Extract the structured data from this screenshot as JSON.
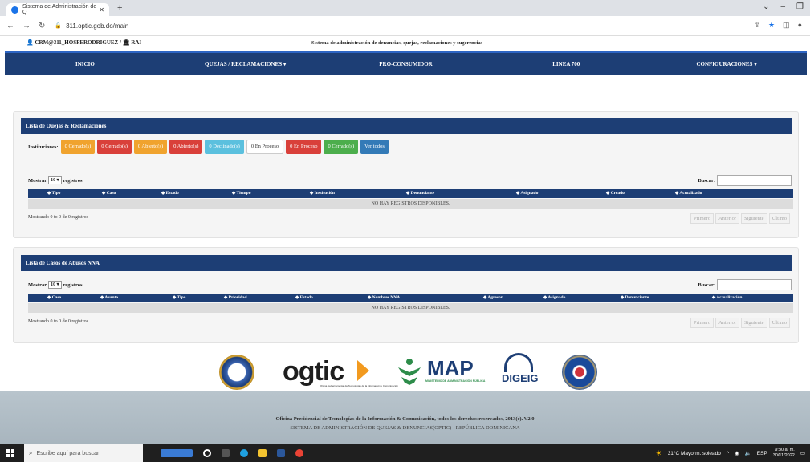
{
  "browser": {
    "tab_title": "Sistema de Administración de Q",
    "url": "311.optic.gob.do/main"
  },
  "header": {
    "user": "CRM@311_HOSPERODRIGUEZ / ",
    "user_suffix": "RAI",
    "system_title": "Sistema de administración de denuncias, quejas, reclamaciones y sugerencias"
  },
  "nav": {
    "items": [
      "INICIO",
      "QUEJAS / RECLAMACIONES ▾",
      "PRO-CONSUMIDOR",
      "LINEA 700",
      "CONFIGURACIONES ▾"
    ]
  },
  "quejas": {
    "title": "Lista de Quejas & Reclamaciones",
    "inst_label": "Instituciones:",
    "buttons": [
      {
        "label": "0 Cerrado(s)",
        "color": "#f0a32e"
      },
      {
        "label": "0 Cerrado(s)",
        "color": "#d9403a"
      },
      {
        "label": "0 Abierto(s)",
        "color": "#f0a32e"
      },
      {
        "label": "0 Abierto(s)",
        "color": "#d9403a"
      },
      {
        "label": "0 Declinado(s)",
        "color": "#5bc0de"
      },
      {
        "label": "0 En Proceso",
        "color": "#ffffff"
      },
      {
        "label": "0 En Proceso",
        "color": "#d9403a"
      },
      {
        "label": "0 Cerrado(s)",
        "color": "#4cae4c"
      },
      {
        "label": "Ver todos",
        "color": "#337ab7"
      }
    ],
    "show_prefix": "Mostrar",
    "show_value": "10",
    "show_suffix": "registros",
    "search_label": "Buscar:",
    "columns": [
      "Tipo",
      "Caso",
      "Estado",
      "Tiempo",
      "Institución",
      "Denunciante",
      "Asignado",
      "Creado",
      "Actualizado"
    ],
    "empty": "NO HAY REGISTROS DISPONIBLES.",
    "info": "Mostrando 0 to 0 de 0 registros",
    "pager": [
      "Primero",
      "Anterior",
      "Siguiente",
      "Ultimo"
    ]
  },
  "nna": {
    "title": "Lista de Casos de Abusos NNA",
    "show_prefix": "Mostrar",
    "show_value": "10",
    "show_suffix": "registros",
    "search_label": "Buscar:",
    "columns": [
      "Caso",
      "Asunto",
      "Tipo",
      "Prioridad",
      "Estado",
      "Nombres NNA",
      "Agresor",
      "Asignado",
      "Denunciante",
      "Actualización"
    ],
    "empty": "NO HAY REGISTROS DISPONIBLES.",
    "info": "Mostrando 0 to 0 de 0 registros",
    "pager": [
      "Primero",
      "Anterior",
      "Siguiente",
      "Ultimo"
    ]
  },
  "logos": {
    "ogtic": "ogtic",
    "ogtic_sub": "Oficina Gubernamental de Tecnologías de la Información y Comunicación",
    "map": "MAP",
    "map_sub": "MINISTERIO DE ADMINISTRACIÓN PÚBLICA",
    "digeig": "DIGEIG"
  },
  "footer": {
    "line1": "Oficina Presidencial de Tecnologías de la Información & Comunicación, todos los derechos reservados, 2013(c). V2.0",
    "line2": "SISTEMA DE ADMINISTRACIÓN DE QUEJAS & DENUNCIAS(OPTIC) - REPÚBLICA DOMINICANA"
  },
  "taskbar": {
    "search_placeholder": "Escribe aquí para buscar",
    "weather": "31°C  Mayorm. soleado",
    "lang": "ESP",
    "time": "9:30 a. m.",
    "date": "30/11/2022"
  }
}
